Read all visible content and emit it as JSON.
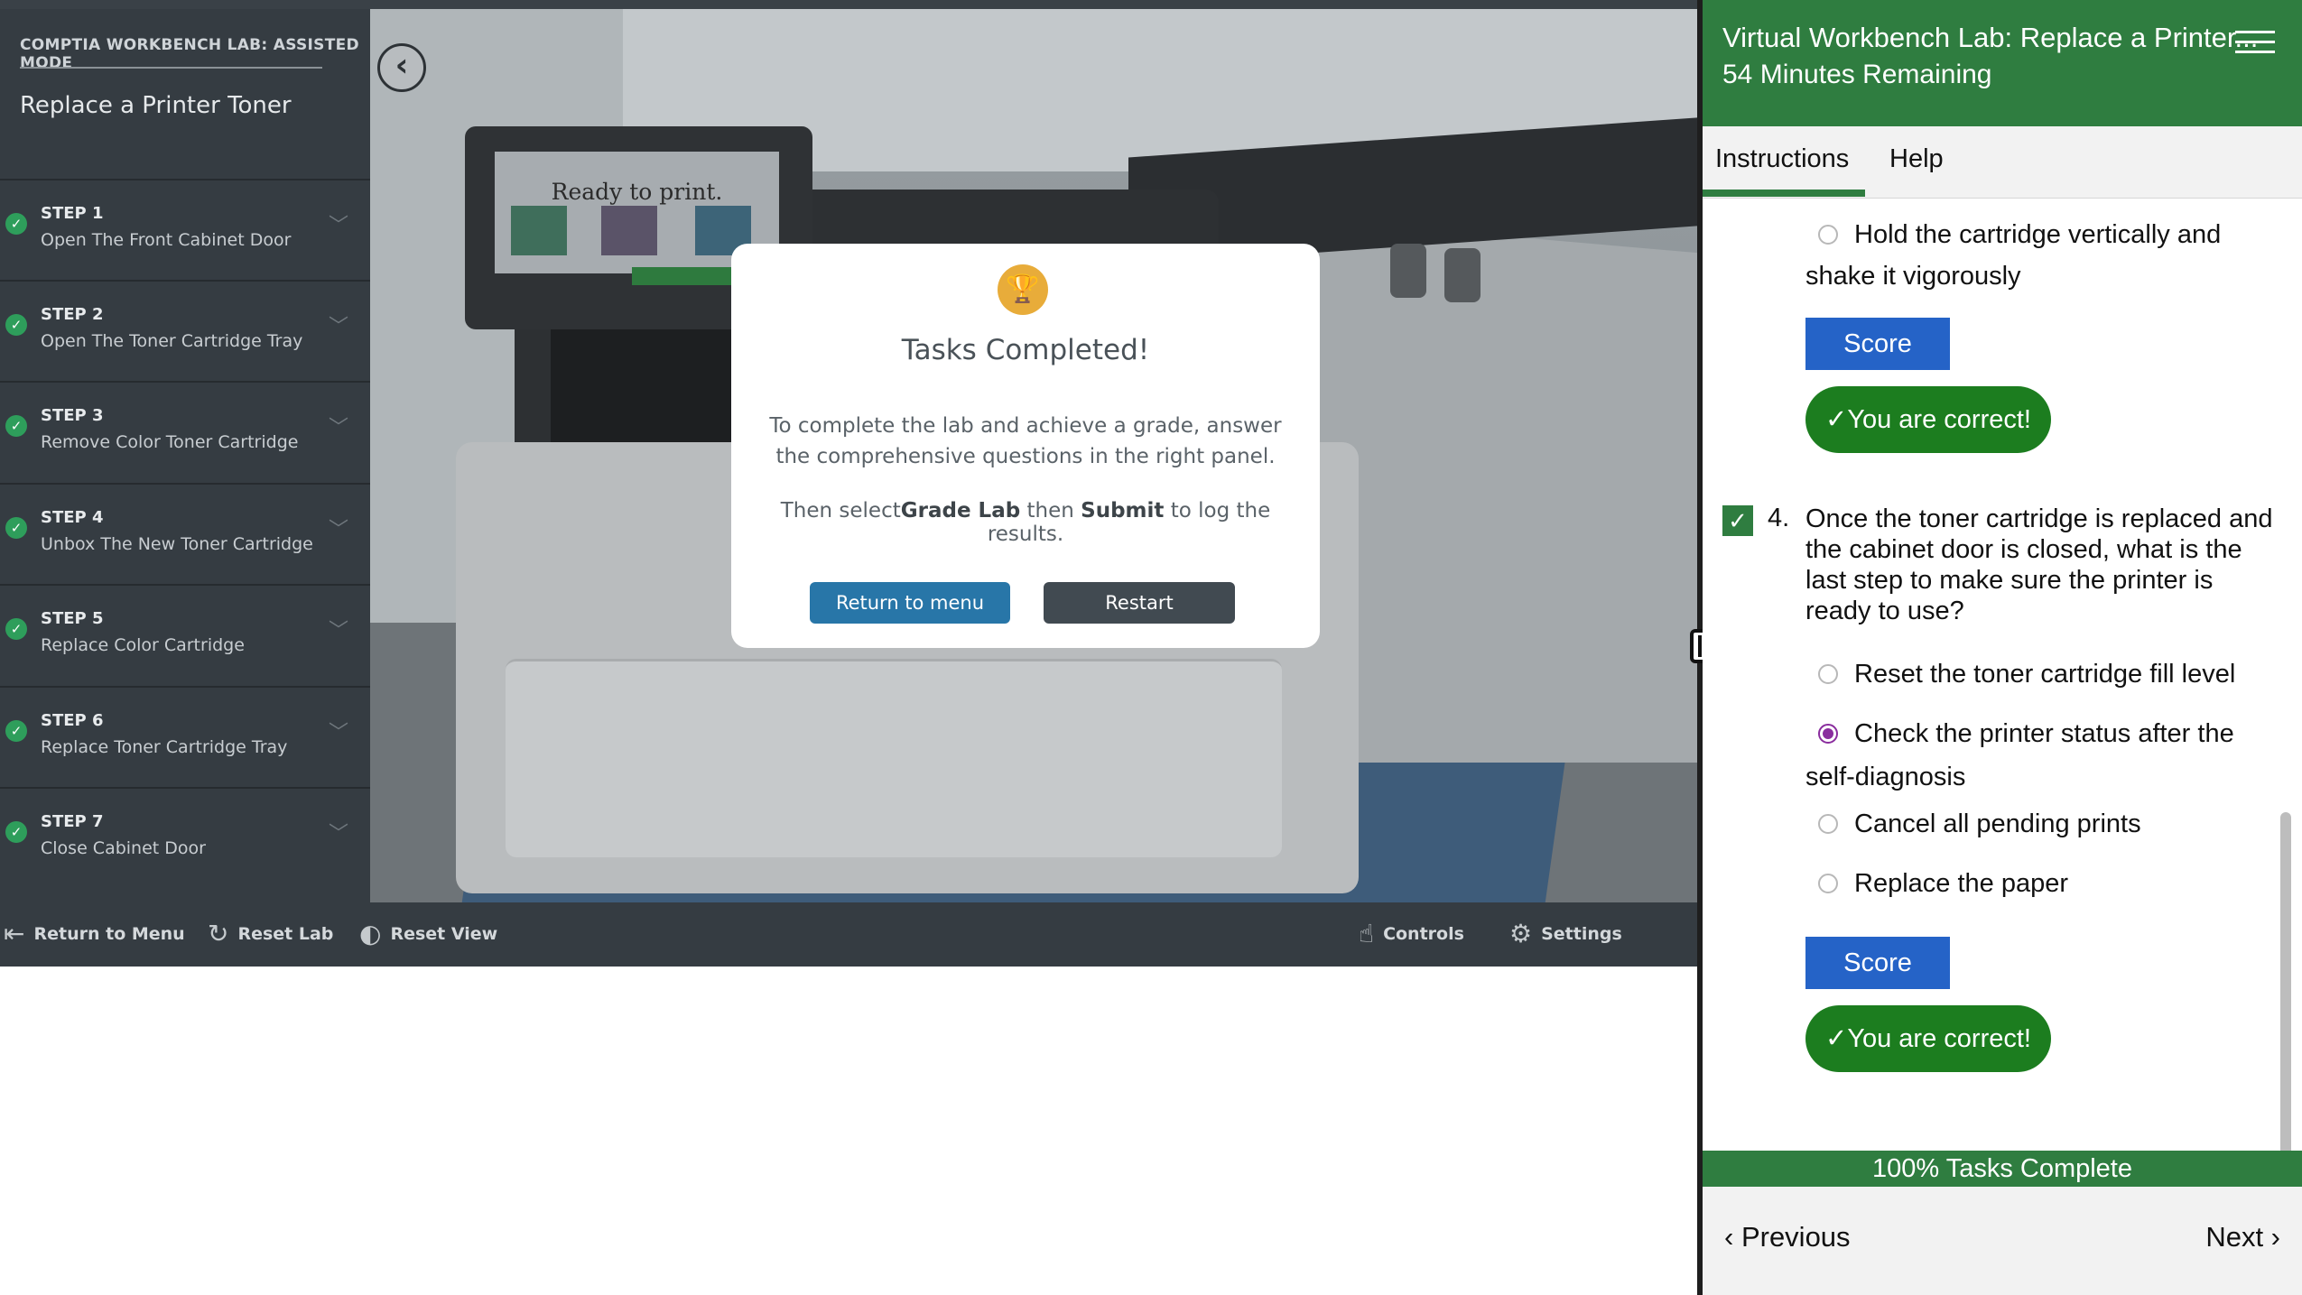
{
  "lab": {
    "mode_label": "COMPTIA WORKBENCH LAB: ASSISTED MODE",
    "title": "Replace a Printer Toner",
    "screen_text": "Ready to print.",
    "steps": [
      {
        "num": "STEP 1",
        "desc": "Open The Front Cabinet Door"
      },
      {
        "num": "STEP 2",
        "desc": "Open The Toner Cartridge Tray"
      },
      {
        "num": "STEP 3",
        "desc": "Remove Color Toner Cartridge"
      },
      {
        "num": "STEP 4",
        "desc": "Unbox The New Toner Cartridge"
      },
      {
        "num": "STEP 5",
        "desc": "Replace Color Cartridge"
      },
      {
        "num": "STEP 6",
        "desc": "Replace Toner Cartridge Tray"
      },
      {
        "num": "STEP 7",
        "desc": "Close Cabinet Door"
      }
    ],
    "toolbar": {
      "return_menu": "Return to Menu",
      "reset_lab": "Reset Lab",
      "reset_view": "Reset View",
      "controls": "Controls",
      "settings": "Settings"
    }
  },
  "modal": {
    "title": "Tasks Completed!",
    "p1": "To complete the lab and achieve a grade, answer the comprehensive questions in the right panel.",
    "p2_a": "Then select",
    "p2_b": "Grade Lab",
    "p2_c": " then ",
    "p2_d": "Submit",
    "p2_e": " to log the results.",
    "return_btn": "Return to menu",
    "restart_btn": "Restart"
  },
  "panel": {
    "title": "Virtual Workbench Lab: Replace a Printer...",
    "time": "54 Minutes Remaining",
    "tabs": [
      "Instructions",
      "Help"
    ],
    "q3": {
      "option_last_line1": "Hold the cartridge vertically and",
      "option_last_line2": "shake it vigorously",
      "score": "Score",
      "feedback": "You are correct!"
    },
    "q4": {
      "number": "4.",
      "text": "Once the toner cartridge is replaced and the cabinet door is closed, what is the last step to make sure the printer is ready to use?",
      "options": [
        "Reset the toner cartridge fill level",
        "Check the printer status after the",
        "self-diagnosis",
        "Cancel all pending prints",
        "Replace the paper"
      ],
      "selected_index": 1,
      "score": "Score",
      "feedback": "You are correct!"
    },
    "progress": "100% Tasks Complete",
    "prev": "Previous",
    "next": "Next"
  },
  "colors": {
    "panel_green": "#2f7d40",
    "score_blue": "#2563c7",
    "correct_green": "#1c7d1f",
    "radio_purple": "#8a2d9e",
    "trophy_gold": "#e8ac3a"
  }
}
